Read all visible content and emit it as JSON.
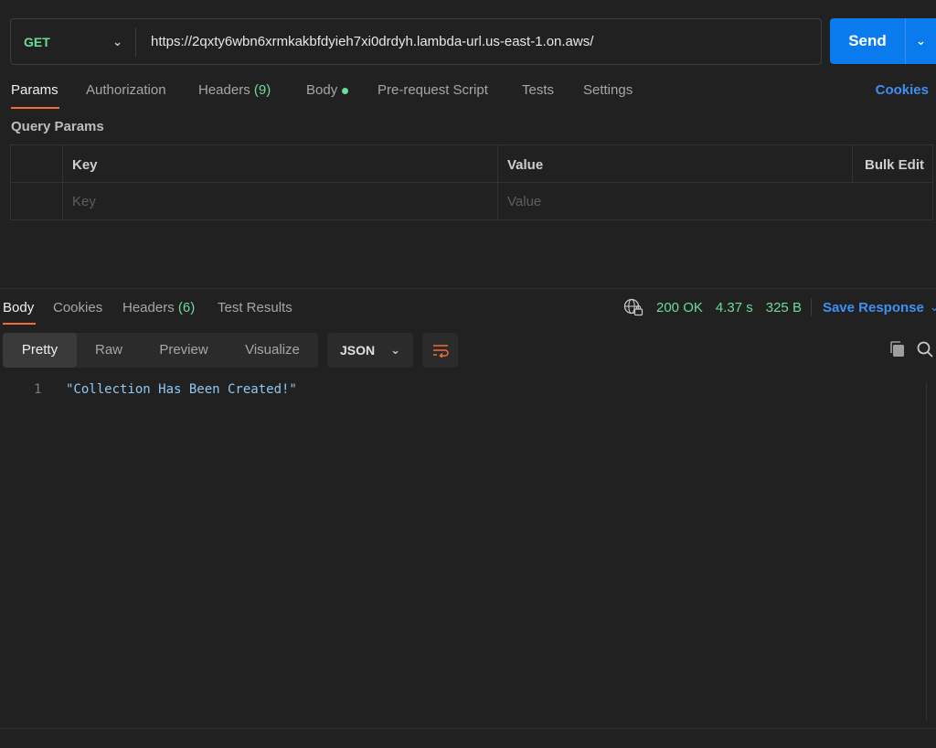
{
  "request": {
    "method": "GET",
    "url": "https://2qxty6wbn6xrmkakbfdyieh7xi0drdyh.lambda-url.us-east-1.on.aws/",
    "send_label": "Send",
    "tabs": [
      {
        "label": "Params"
      },
      {
        "label": "Authorization"
      },
      {
        "label": "Headers",
        "count": "(9)"
      },
      {
        "label": "Body"
      },
      {
        "label": "Pre-request Script"
      },
      {
        "label": "Tests"
      },
      {
        "label": "Settings"
      }
    ],
    "cookies_label": "Cookies",
    "query_params_title": "Query Params",
    "table": {
      "key_header": "Key",
      "value_header": "Value",
      "bulk_edit": "Bulk Edit",
      "key_placeholder": "Key",
      "value_placeholder": "Value"
    }
  },
  "response": {
    "tabs": [
      {
        "label": "Body"
      },
      {
        "label": "Cookies"
      },
      {
        "label": "Headers",
        "count": "(6)"
      },
      {
        "label": "Test Results"
      }
    ],
    "status": "200 OK",
    "time": "4.37 s",
    "size": "325 B",
    "save_label": "Save Response",
    "views": [
      "Pretty",
      "Raw",
      "Preview",
      "Visualize"
    ],
    "format": "JSON",
    "lines": [
      {
        "number": "1",
        "text": "\"Collection Has Been Created!\""
      }
    ]
  },
  "colors": {
    "accent": "#f26b3a",
    "send": "#097bed",
    "success": "#6bdd9a",
    "link": "#3d90f5"
  }
}
